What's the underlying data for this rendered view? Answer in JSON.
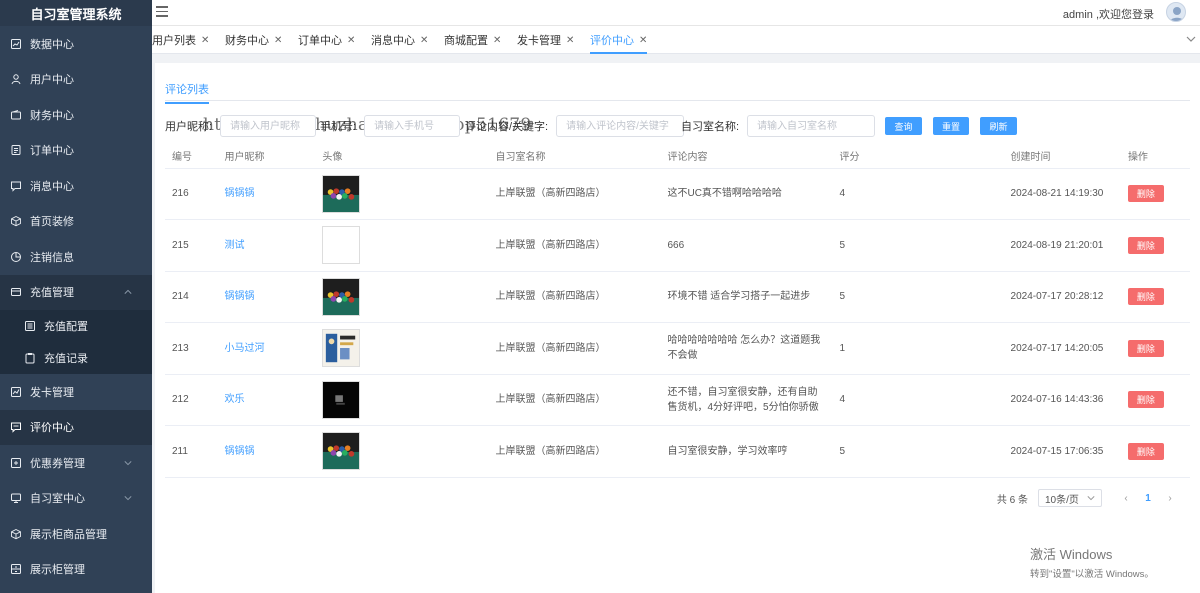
{
  "app": {
    "title": "自习室管理系统"
  },
  "watermark": "https://www.huzhan.com/ishop51679",
  "header": {
    "user_text": "admin ,欢迎您登录"
  },
  "sidebar": {
    "items": [
      {
        "label": "数据中心",
        "icon": "dashboard-icon"
      },
      {
        "label": "用户中心",
        "icon": "user-icon"
      },
      {
        "label": "财务中心",
        "icon": "wallet-icon"
      },
      {
        "label": "订单中心",
        "icon": "document-icon"
      },
      {
        "label": "消息中心",
        "icon": "message-icon"
      },
      {
        "label": "首页装修",
        "icon": "cube-icon"
      },
      {
        "label": "注销信息",
        "icon": "pie-icon"
      },
      {
        "label": "充值管理",
        "icon": "card-icon"
      },
      {
        "label": "充值配置",
        "icon": "list-icon"
      },
      {
        "label": "充值记录",
        "icon": "clipboard-icon"
      },
      {
        "label": "发卡管理",
        "icon": "chart-icon"
      },
      {
        "label": "评价中心",
        "icon": "comment-icon"
      },
      {
        "label": "优惠券管理",
        "icon": "ticket-icon"
      },
      {
        "label": "自习室中心",
        "icon": "monitor-icon"
      },
      {
        "label": "展示柜商品管理",
        "icon": "box-icon"
      },
      {
        "label": "展示柜管理",
        "icon": "cabinet-icon"
      }
    ]
  },
  "tabs": [
    {
      "label": "用户列表"
    },
    {
      "label": "财务中心"
    },
    {
      "label": "订单中心"
    },
    {
      "label": "消息中心"
    },
    {
      "label": "商城配置"
    },
    {
      "label": "发卡管理"
    },
    {
      "label": "评价中心"
    }
  ],
  "subtab": "评论列表",
  "filters": {
    "nickname": {
      "label": "用户昵称:",
      "placeholder": "请输入用户昵称"
    },
    "phone": {
      "label": "手机号:",
      "placeholder": "请输入手机号"
    },
    "content": {
      "label": "评论内容/关键字:",
      "placeholder": "请输入评论内容/关键字"
    },
    "room": {
      "label": "自习室名称:",
      "placeholder": "请输入自习室名称"
    }
  },
  "buttons": {
    "query": "查询",
    "reset": "重置",
    "refresh": "刷新"
  },
  "table": {
    "headers": [
      "编号",
      "用户昵称",
      "头像",
      "自习室名称",
      "评论内容",
      "评分",
      "创建时间",
      "操作"
    ],
    "rows": [
      {
        "id": "216",
        "nickname": "锅锅锅",
        "avatar": "billiards",
        "room": "上岸联盟（高新四路店）",
        "comment": "这不UC真不错啊哈哈哈哈",
        "score": "4",
        "created": "2024-08-21 14:19:30",
        "action": "删除"
      },
      {
        "id": "215",
        "nickname": "测试",
        "avatar": "blank",
        "room": "上岸联盟（高新四路店）",
        "comment": "666",
        "score": "5",
        "created": "2024-08-19 21:20:01",
        "action": "删除"
      },
      {
        "id": "214",
        "nickname": "锅锅锅",
        "avatar": "billiards",
        "room": "上岸联盟（高新四路店）",
        "comment": "环境不错 适合学习搭子一起进步",
        "score": "5",
        "created": "2024-07-17 20:28:12",
        "action": "删除"
      },
      {
        "id": "213",
        "nickname": "小马过河",
        "avatar": "poster",
        "room": "上岸联盟（高新四路店）",
        "comment": "哈哈哈哈哈哈哈 怎么办？这道题我不会做",
        "score": "1",
        "created": "2024-07-17 14:20:05",
        "action": "删除"
      },
      {
        "id": "212",
        "nickname": "欢乐",
        "avatar": "dark",
        "room": "上岸联盟（高新四路店）",
        "comment": "还不错，自习室很安静，还有自助售货机，4分好评吧，5分怕你骄傲",
        "score": "4",
        "created": "2024-07-16 14:43:36",
        "action": "删除"
      },
      {
        "id": "211",
        "nickname": "锅锅锅",
        "avatar": "billiards",
        "room": "上岸联盟（高新四路店）",
        "comment": "自习室很安静，学习效率哼",
        "score": "5",
        "created": "2024-07-15 17:06:35",
        "action": "删除"
      }
    ]
  },
  "pagination": {
    "total": "共 6 条",
    "page_size": "10条/页",
    "current_page": "1",
    "prev": "‹",
    "next": "›"
  },
  "windows_activation": {
    "line1": "激活 Windows",
    "line2": "转到\"设置\"以激活 Windows。"
  },
  "colors": {
    "sidebar_bg": "#304156",
    "primary": "#409eff",
    "danger": "#f56c6c"
  }
}
